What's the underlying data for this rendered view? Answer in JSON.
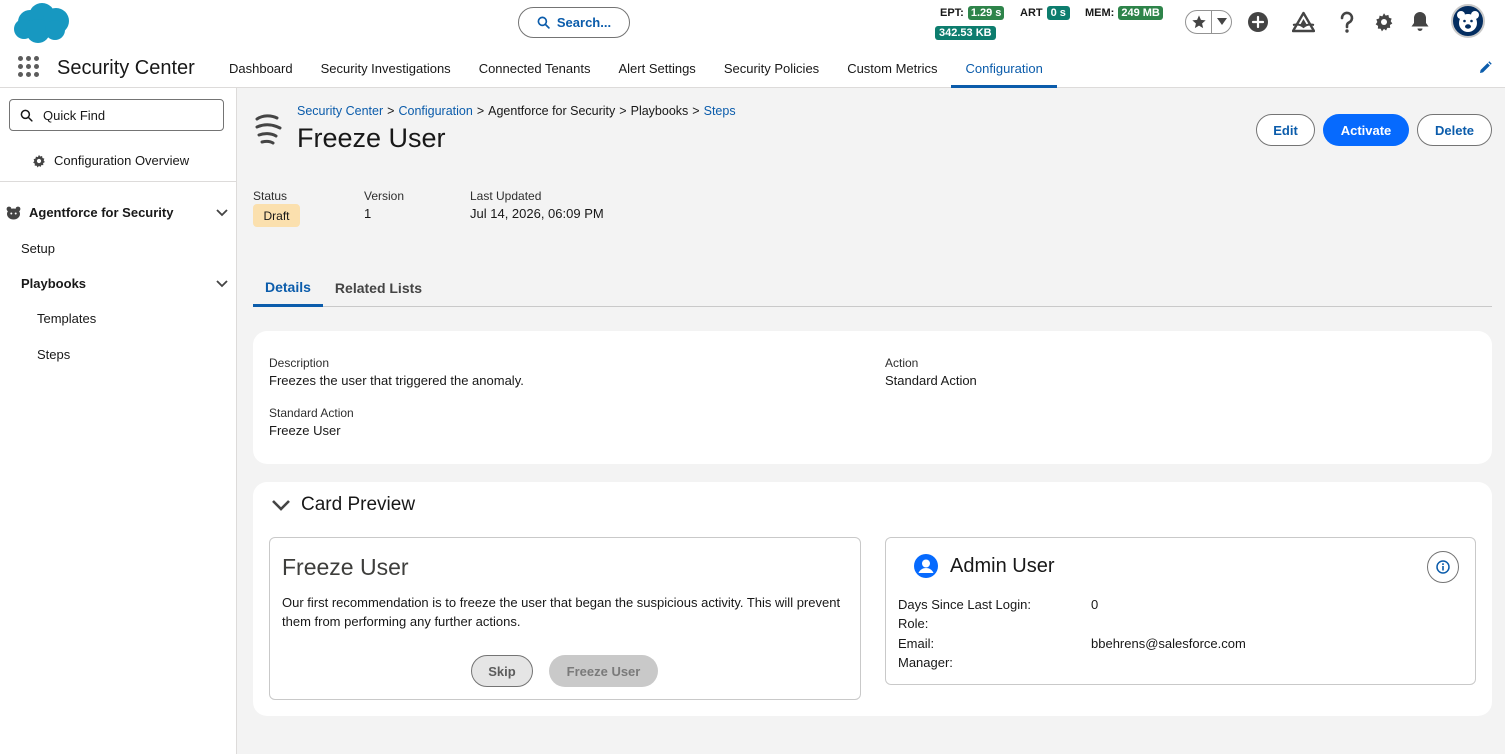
{
  "header": {
    "search_label": "Search...",
    "perf": {
      "ept_label": "EPT:",
      "ept_value": "1.29 s",
      "art_label": "ART",
      "art_value": "0 s",
      "mem_label": "MEM:",
      "mem_value": "249 MB",
      "size_value": "342.53 KB"
    },
    "app_name": "Security Center",
    "nav": [
      "Dashboard",
      "Security Investigations",
      "Connected Tenants",
      "Alert Settings",
      "Security Policies",
      "Custom Metrics",
      "Configuration"
    ],
    "active_nav": "Configuration"
  },
  "sidebar": {
    "quick_find_placeholder": "Quick Find",
    "config_overview": "Configuration Overview",
    "section": "Agentforce for Security",
    "setup": "Setup",
    "playbooks": "Playbooks",
    "templates": "Templates",
    "steps": "Steps"
  },
  "record": {
    "breadcrumb": [
      "Security Center",
      ">",
      "Configuration",
      ">",
      "Agentforce for Security",
      ">",
      "Playbooks",
      ">",
      "Steps"
    ],
    "title": "Freeze User",
    "buttons": {
      "edit": "Edit",
      "activate": "Activate",
      "delete": "Delete"
    },
    "status_label": "Status",
    "status_value": "Draft",
    "version_label": "Version",
    "version_value": "1",
    "updated_label": "Last Updated",
    "updated_value": "Jul 14, 2026, 06:09 PM"
  },
  "tabs": [
    "Details",
    "Related Lists"
  ],
  "details": {
    "description_label": "Description",
    "description_value": "Freezes the user that triggered the anomaly.",
    "action_label": "Action",
    "action_value": "Standard Action",
    "standard_action_label": "Standard Action",
    "standard_action_value": "Freeze User"
  },
  "card_preview": {
    "title": "Card Preview",
    "left": {
      "title": "Freeze User",
      "body": "Our first recommendation is to freeze the user that began the suspicious activity. This will prevent them from performing any further actions.",
      "skip": "Skip",
      "freeze": "Freeze User"
    },
    "right": {
      "title": "Admin User",
      "rows": [
        {
          "label": "Days Since Last Login:",
          "value": "0"
        },
        {
          "label": "Role:",
          "value": ""
        },
        {
          "label": "Email:",
          "value": "bbehrens@salesforce.com"
        },
        {
          "label": "Manager:",
          "value": ""
        }
      ]
    }
  },
  "colors": {
    "brand": "#066afe",
    "link": "#0b5cab",
    "draft": "#fbe0ae",
    "perf_green": "#2e844a"
  }
}
